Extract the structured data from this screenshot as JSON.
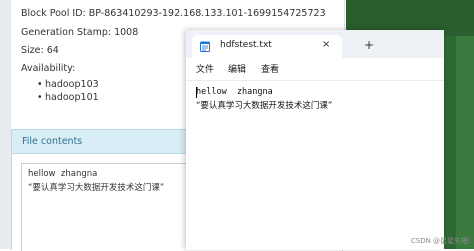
{
  "block_info": {
    "block_pool_id": "Block Pool ID: BP-863410293-192.168.133.101-1699154725723",
    "generation_stamp": "Generation Stamp: 1008",
    "size": "Size: 64",
    "availability_label": "Availability:",
    "availability_hosts": [
      "hadoop103",
      "hadoop101"
    ]
  },
  "file_contents": {
    "header": "File contents",
    "lines": [
      "hellow  zhangna",
      "“要认真学习大数据开发技术这门课”"
    ]
  },
  "notepad": {
    "tab_title": "hdfstest.txt",
    "close_glyph": "×",
    "add_glyph": "+",
    "menu": [
      "文件",
      "编辑",
      "查看"
    ],
    "lines": [
      "hellow  zhangna",
      "“要认真学习大数据开发技术这门课”"
    ]
  },
  "watermark": "CSDN @星星失眠i",
  "colors": {
    "panel_header_bg": "#d9edf7",
    "panel_header_text": "#31708f",
    "notepad_icon": "#1e6fd6",
    "desktop_green": "#2d6a33"
  }
}
